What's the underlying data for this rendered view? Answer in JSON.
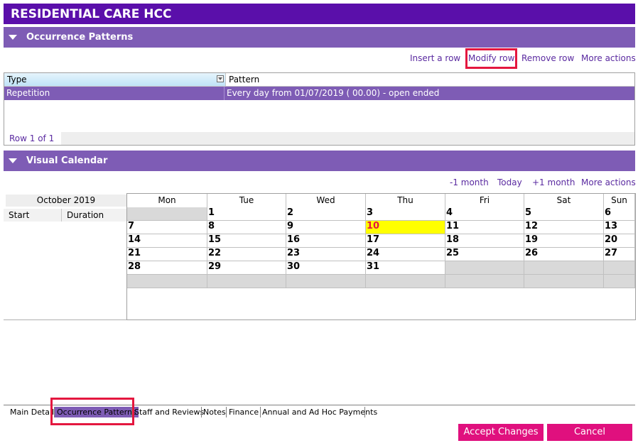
{
  "window": {
    "title": "RESIDENTIAL CARE HCC"
  },
  "occurrence_patterns": {
    "header": "Occurrence Patterns",
    "actions": {
      "insert": "Insert a row",
      "modify": "Modify row",
      "remove": "Remove row",
      "more": "More actions"
    },
    "columns": [
      "Type",
      "Pattern"
    ],
    "rows": [
      {
        "type": "Repetition",
        "pattern": "Every day from 01/07/2019 ( 00.00) - open ended"
      }
    ],
    "row_count": "Row 1 of 1"
  },
  "visual_calendar": {
    "header": "Visual Calendar",
    "actions": {
      "prev": "-1 month",
      "today": "Today",
      "next": "+1 month",
      "more": "More actions"
    },
    "month_label": "October 2019",
    "left_columns": [
      "Start",
      "Duration"
    ],
    "weekdays": [
      "Mon",
      "Tue",
      "Wed",
      "Thu",
      "Fri",
      "Sat",
      "Sun"
    ],
    "weeks": [
      [
        "",
        "1",
        "2",
        "3",
        "4",
        "5",
        "6"
      ],
      [
        "7",
        "8",
        "9",
        "10",
        "11",
        "12",
        "13"
      ],
      [
        "14",
        "15",
        "16",
        "17",
        "18",
        "19",
        "20"
      ],
      [
        "21",
        "22",
        "23",
        "24",
        "25",
        "26",
        "27"
      ],
      [
        "28",
        "29",
        "30",
        "31",
        "",
        "",
        ""
      ],
      [
        "",
        "",
        "",
        "",
        "",
        "",
        ""
      ]
    ],
    "today": "10"
  },
  "tabs": [
    "Main Details",
    "Occurrence Patterns",
    "Staff and Reviews",
    "Notes",
    "Finance",
    "Annual and Ad Hoc Payments"
  ],
  "active_tab": "Occurrence Patterns",
  "buttons": {
    "accept": "Accept Changes",
    "cancel": "Cancel"
  },
  "colors": {
    "title_bar": "#5a0faa",
    "section_header": "#7e5cb5",
    "accent_button": "#e0107e",
    "highlight_box": "#e4173f",
    "today": "#ffff00"
  }
}
